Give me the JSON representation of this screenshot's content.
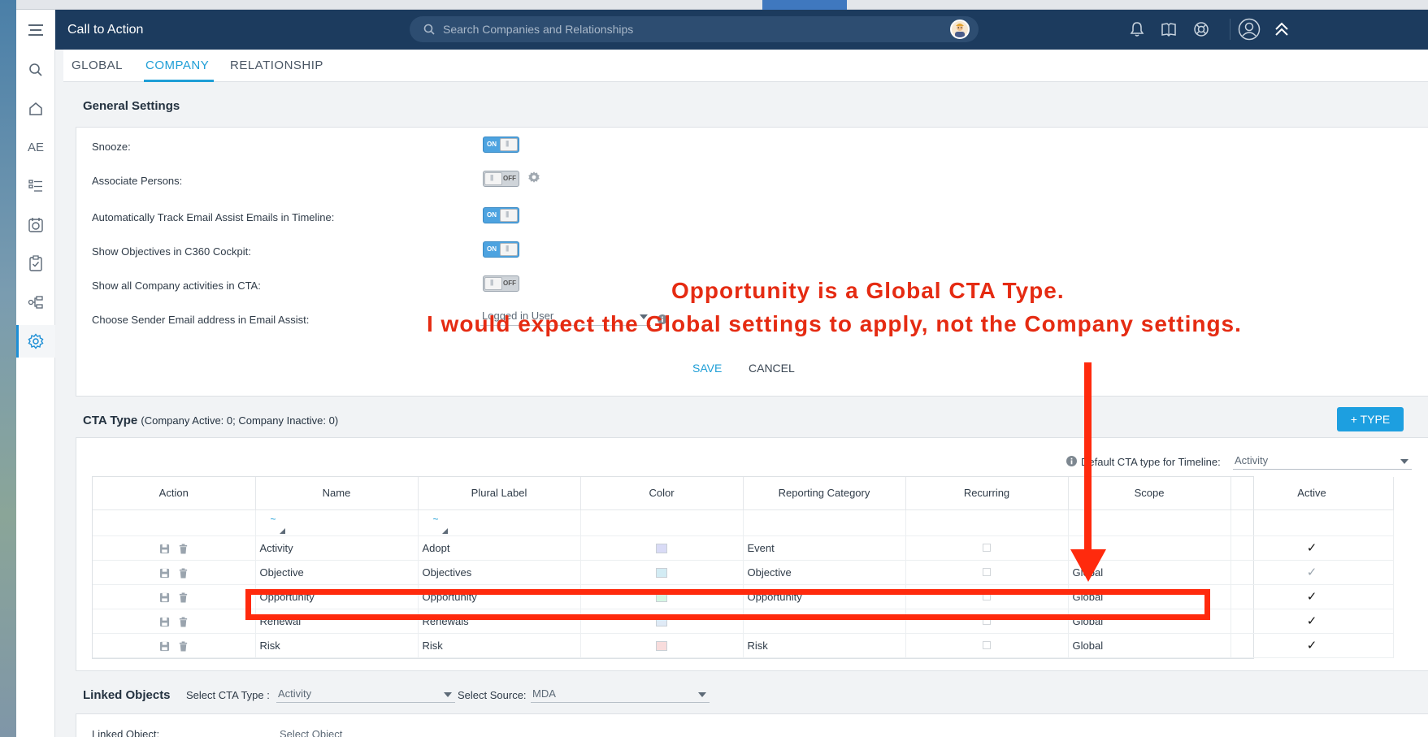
{
  "topbar": {
    "title": "Call to Action",
    "search_placeholder": "Search Companies and Relationships"
  },
  "tabs": [
    {
      "label": "GLOBAL",
      "active": false
    },
    {
      "label": "COMPANY",
      "active": true
    },
    {
      "label": "RELATIONSHIP",
      "active": false
    }
  ],
  "sidebar": {
    "ae_label": "AE"
  },
  "general_settings": {
    "title": "General Settings",
    "rows": [
      {
        "label": "Snooze:",
        "state": "ON"
      },
      {
        "label": "Associate Persons:",
        "state": "OFF"
      },
      {
        "label": "Automatically Track Email Assist Emails in Timeline:",
        "state": "ON"
      },
      {
        "label": "Show Objectives in C360 Cockpit:",
        "state": "ON"
      },
      {
        "label": "Show all Company activities in CTA:",
        "state": "OFF"
      },
      {
        "label": "Choose Sender Email address in Email Assist:",
        "value": "Logged in User"
      }
    ],
    "save_label": "SAVE",
    "cancel_label": "CANCEL"
  },
  "cta_type": {
    "title": "CTA Type",
    "subtitle": "(Company Active: 0; Company Inactive: 0)",
    "add_button": "+ TYPE",
    "default_label": "Default CTA type for Timeline:",
    "default_value": "Activity",
    "columns": [
      "Action",
      "Name",
      "Plural Label",
      "Color",
      "Reporting Category",
      "Recurring",
      "Scope",
      "Active"
    ],
    "rows": [
      {
        "name": "Activity",
        "plural": "Adopt",
        "color": "#d9dbf6",
        "category": "Event",
        "scope": "",
        "active": "✓"
      },
      {
        "name": "Objective",
        "plural": "Objectives",
        "color": "#d3ecf4",
        "category": "Objective",
        "scope": "Global",
        "active": "✓"
      },
      {
        "name": "Opportunity",
        "plural": "Opportunity",
        "color": "#d5f6e4",
        "category": "Opportunity",
        "scope": "Global",
        "active": "✓"
      },
      {
        "name": "Renewal",
        "plural": "Renewals",
        "color": "#dfeaf6",
        "category": "",
        "scope": "Global",
        "active": "✓"
      },
      {
        "name": "Risk",
        "plural": "Risk",
        "color": "#f8dcdc",
        "category": "Risk",
        "scope": "Global",
        "active": "✓"
      }
    ]
  },
  "linked_objects": {
    "title": "Linked Objects",
    "cta_type_label": "Select CTA Type :",
    "cta_type_value": "Activity",
    "source_label": "Select Source:",
    "source_value": "MDA",
    "linked_object_label": "Linked Object:",
    "linked_object_value": "Select Object"
  },
  "annotation": {
    "line1": "Opportunity is a Global CTA Type.",
    "line2": "I would expect the Global settings to apply, not the Company settings."
  },
  "colors": {
    "topbar": "#1c3b5e",
    "accent": "#1e9ed6",
    "annotation": "#ff2a0d"
  }
}
